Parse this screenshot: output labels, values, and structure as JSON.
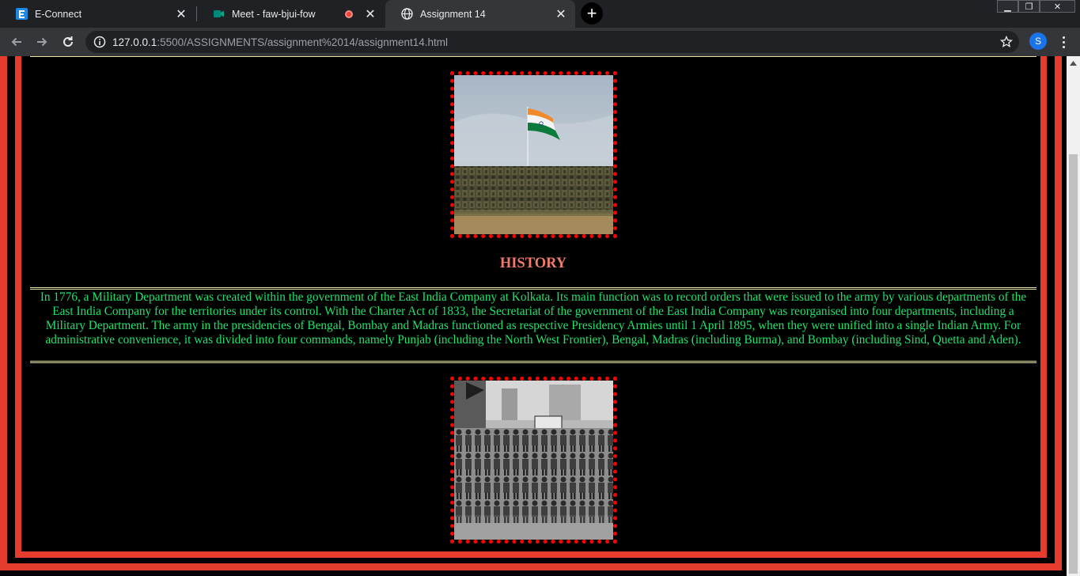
{
  "browser": {
    "tabs": [
      {
        "title": "E-Connect",
        "icon": "econnect-icon"
      },
      {
        "title": "Meet - faw-bjui-fow",
        "icon": "meet-icon",
        "recording": true
      },
      {
        "title": "Assignment 14",
        "icon": "globe-icon",
        "active": true
      }
    ],
    "url_host": "127.0.0.1",
    "url_path": ":5500/ASSIGNMENTS/assignment%2014/assignment14.html",
    "profile_initial": "S",
    "accent_color": "#1a73e8"
  },
  "page": {
    "heading": "HISTORY",
    "paragraph": "In 1776, a Military Department was created within the government of the East India Company at Kolkata. Its main function was to record orders that were issued to the army by various departments of the East India Company for the territories under its control. With the Charter Act of 1833, the Secretariat of the government of the East India Company was reorganised into four departments, including a Military Department. The army in the presidencies of Bengal, Bombay and Madras functioned as respective Presidency Armies until 1 April 1895, when they were unified into a single Indian Army. For administrative convenience, it was divided into four commands, namely Punjab (including the North West Frontier), Bengal, Madras (including Burma), and Bombay (including Sind, Quetta and Aden).",
    "colors": {
      "frame": "#e63c2e",
      "heading": "#f07a6e",
      "paragraph": "#1ee36e",
      "photo_border": "#ff0000"
    }
  }
}
